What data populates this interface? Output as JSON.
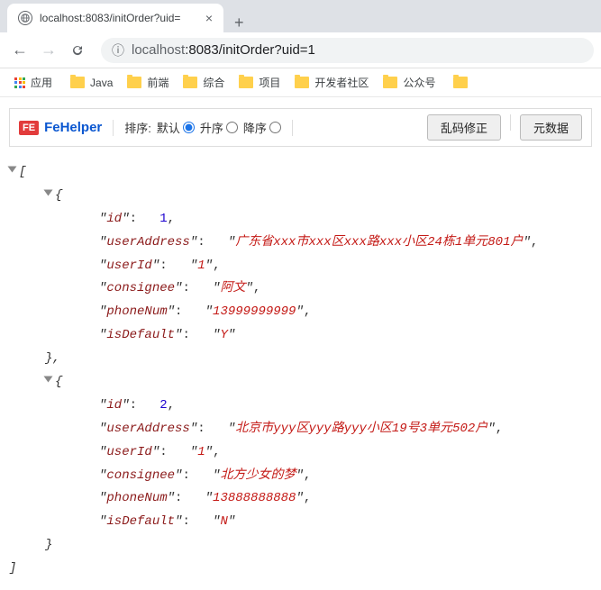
{
  "browser": {
    "tab_title": "localhost:8083/initOrder?uid=",
    "url_host": "localhost",
    "url_path": ":8083/initOrder?uid=1",
    "apps_label": "应用",
    "bookmarks": [
      "Java",
      "前端",
      "综合",
      "项目",
      "开发者社区",
      "公众号"
    ]
  },
  "fehelper": {
    "brand": "FeHelper",
    "sort_label": "排序:",
    "opt_default": "默认",
    "opt_asc": "升序",
    "opt_desc": "降序",
    "btn_fix": "乱码修正",
    "btn_meta": "元数据",
    "selected": "default"
  },
  "json_items": [
    {
      "id": 1,
      "userAddress": "广东省xxx市xxx区xxx路xxx小区24栋1单元801户",
      "userId": "1",
      "consignee": "阿文",
      "phoneNum": "13999999999",
      "isDefault": "Y"
    },
    {
      "id": 2,
      "userAddress": "北京市yyy区yyy路yyy小区19号3单元502户",
      "userId": "1",
      "consignee": "北方少女的梦",
      "phoneNum": "13888888888",
      "isDefault": "N"
    }
  ]
}
